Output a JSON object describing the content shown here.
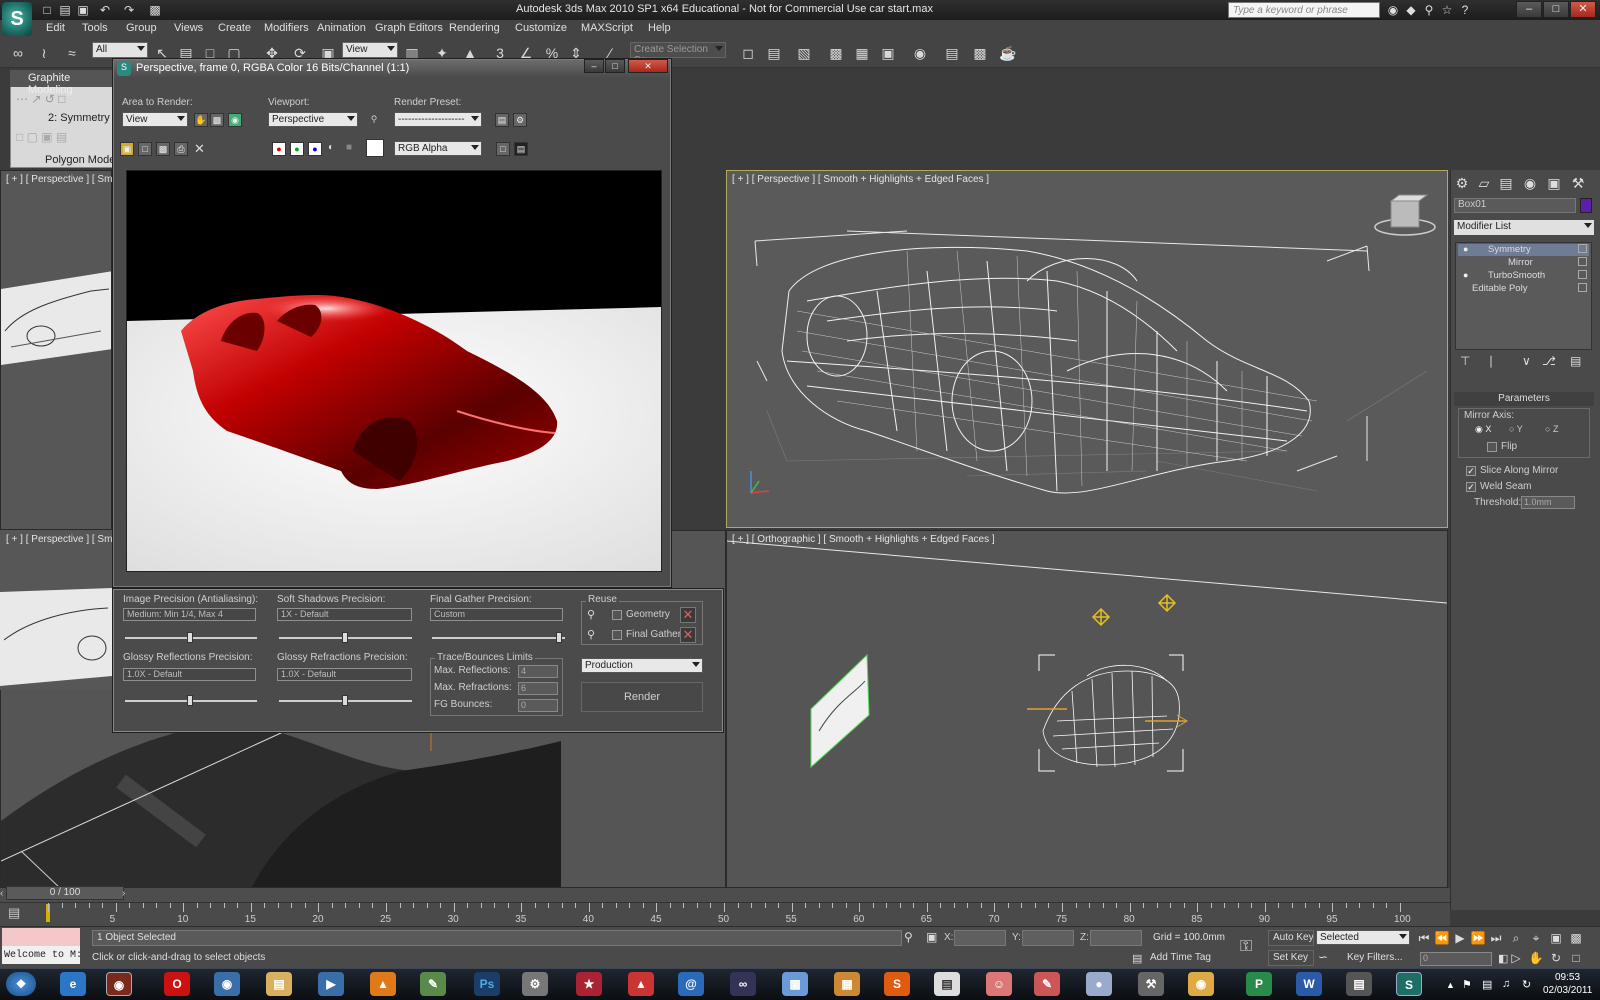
{
  "titlebar": {
    "title": "Autodesk 3ds Max  2010 SP1 x64   Educational - Not for Commercial Use      car start.max",
    "search_placeholder": "Type a keyword or phrase"
  },
  "menu": [
    "Edit",
    "Tools",
    "Group",
    "Views",
    "Create",
    "Modifiers",
    "Animation",
    "Graph Editors",
    "Rendering",
    "Customize",
    "MAXScript",
    "Help"
  ],
  "toolbar": {
    "selection_filter": "All",
    "reference_coord": "View",
    "named_selection_placeholder": "Create Selection Se",
    "snap_3": "3",
    "angle_snap": "%"
  },
  "ribbon": {
    "tab": "Graphite Modeling",
    "current_modifier": "2: Symmetry",
    "panel": "Polygon Model"
  },
  "viewports": {
    "top_left_label": "[ + ] [ Perspective ] [ Smoo",
    "bottom_left_label": "[ + ] [ Perspective ] [ Smoo",
    "top_right_label": "[ + ] [ Perspective ] [ Smooth + Highlights + Edged Faces ]",
    "bottom_right_label": "[ + ] [ Orthographic ] [ Smooth + Highlights + Edged Faces ]"
  },
  "render_window": {
    "title": "Perspective, frame 0, RGBA Color 16 Bits/Channel (1:1)",
    "area_to_render_label": "Area to Render:",
    "area_to_render_value": "View",
    "viewport_label": "Viewport:",
    "viewport_value": "Perspective",
    "render_preset_label": "Render Preset:",
    "render_preset_value": "--------------------",
    "channel_value": "RGB Alpha"
  },
  "render_settings": {
    "image_precision_label": "Image Precision (Antialiasing):",
    "image_precision_value": "Medium: Min 1/4, Max 4",
    "soft_shadows_label": "Soft Shadows Precision:",
    "soft_shadows_value": "1X - Default",
    "final_gather_label": "Final Gather Precision:",
    "final_gather_value": "Custom",
    "glossy_reflections_label": "Glossy Reflections Precision:",
    "glossy_reflections_value": "1.0X - Default",
    "glossy_refractions_label": "Glossy Refractions Precision:",
    "glossy_refractions_value": "1.0X - Default",
    "reuse_label": "Reuse",
    "reuse_geometry": "Geometry",
    "reuse_final_gather": "Final Gather",
    "trace_label": "Trace/Bounces Limits",
    "max_reflections_label": "Max. Reflections:",
    "max_reflections_value": "4",
    "max_refractions_label": "Max. Refractions:",
    "max_refractions_value": "6",
    "fg_bounces_label": "FG Bounces:",
    "fg_bounces_value": "0",
    "mode": "Production",
    "render_button": "Render"
  },
  "command_panel": {
    "object_name": "Box01",
    "object_color": "#5b1fa8",
    "modifier_list": "Modifier List",
    "stack": [
      "Symmetry",
      "Mirror",
      "TurboSmooth",
      "Editable Poly"
    ],
    "parameters_header": "Parameters",
    "mirror_axis_label": "Mirror Axis:",
    "axis_x": "X",
    "axis_y": "Y",
    "axis_z": "Z",
    "flip_label": "Flip",
    "slice_label": "Slice Along Mirror",
    "weld_label": "Weld Seam",
    "threshold_label": "Threshold:",
    "threshold_value": "1.0mm"
  },
  "timeline": {
    "frame_display": "0 / 100",
    "ticks": [
      "5",
      "10",
      "15",
      "20",
      "25",
      "30",
      "35",
      "40",
      "45",
      "50",
      "55",
      "60",
      "65",
      "70",
      "75",
      "80",
      "85",
      "90",
      "95",
      "100"
    ]
  },
  "status": {
    "selection": "1 Object Selected",
    "prompt": "Click or click-and-drag to select objects",
    "welcome": "Welcome to M:",
    "x_label": "X:",
    "y_label": "Y:",
    "z_label": "Z:",
    "grid": "Grid = 100.0mm",
    "add_time_tag": "Add Time Tag",
    "auto_key": "Auto Key",
    "auto_key_mode": "Selected",
    "set_key": "Set Key",
    "key_filters": "Key Filters...",
    "current_frame": "0"
  },
  "taskbar": {
    "time": "09:53",
    "date": "02/03/2011",
    "apps": [
      "start",
      "ie",
      "firefox",
      "opera",
      "ps",
      "word",
      "3dsmax"
    ]
  }
}
